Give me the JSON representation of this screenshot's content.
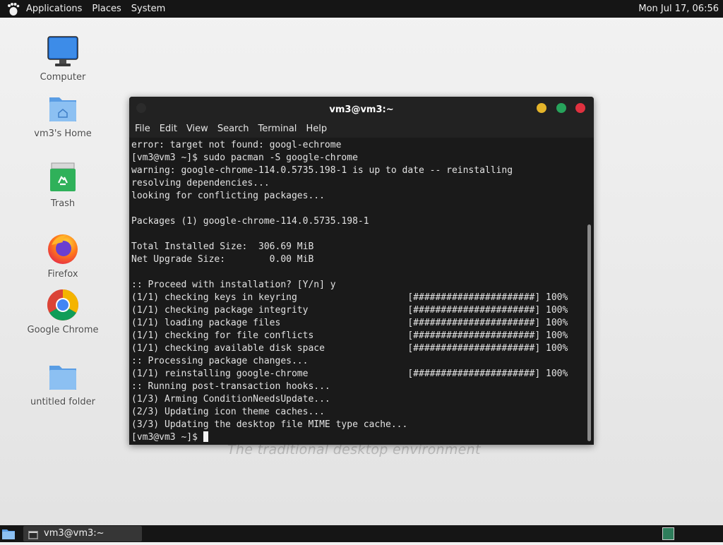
{
  "top_panel": {
    "menus": [
      "Applications",
      "Places",
      "System"
    ],
    "clock": "Mon Jul 17, 06:56"
  },
  "desktop": {
    "icons": [
      {
        "label": "Computer",
        "icon": "monitor-icon"
      },
      {
        "label": "vm3's Home",
        "icon": "home-folder-icon"
      },
      {
        "label": "Trash",
        "icon": "trash-icon"
      },
      {
        "label": "Firefox",
        "icon": "firefox-icon"
      },
      {
        "label": "Google Chrome",
        "icon": "chrome-icon"
      },
      {
        "label": "untitled folder",
        "icon": "folder-icon"
      }
    ],
    "wallpaper_text": "The traditional desktop environment"
  },
  "terminal": {
    "title": "vm3@vm3:~",
    "menu": [
      "File",
      "Edit",
      "View",
      "Search",
      "Terminal",
      "Help"
    ],
    "lines": [
      "error: target not found: googl-echrome",
      "[vm3@vm3 ~]$ sudo pacman -S google-chrome",
      "warning: google-chrome-114.0.5735.198-1 is up to date -- reinstalling",
      "resolving dependencies...",
      "looking for conflicting packages...",
      "",
      "Packages (1) google-chrome-114.0.5735.198-1",
      "",
      "Total Installed Size:  306.69 MiB",
      "Net Upgrade Size:        0.00 MiB",
      "",
      ":: Proceed with installation? [Y/n] y",
      "(1/1) checking keys in keyring                    [######################] 100%",
      "(1/1) checking package integrity                  [######################] 100%",
      "(1/1) loading package files                       [######################] 100%",
      "(1/1) checking for file conflicts                 [######################] 100%",
      "(1/1) checking available disk space               [######################] 100%",
      ":: Processing package changes...",
      "(1/1) reinstalling google-chrome                  [######################] 100%",
      ":: Running post-transaction hooks...",
      "(1/3) Arming ConditionNeedsUpdate...",
      "(2/3) Updating icon theme caches...",
      "(3/3) Updating the desktop file MIME type cache..."
    ],
    "prompt": "[vm3@vm3 ~]$ ",
    "colors": {
      "close": "#e0313f",
      "maximize": "#27a35b",
      "minimize": "#e4b42a"
    }
  },
  "taskbar": {
    "window_title": "vm3@vm3:~"
  }
}
